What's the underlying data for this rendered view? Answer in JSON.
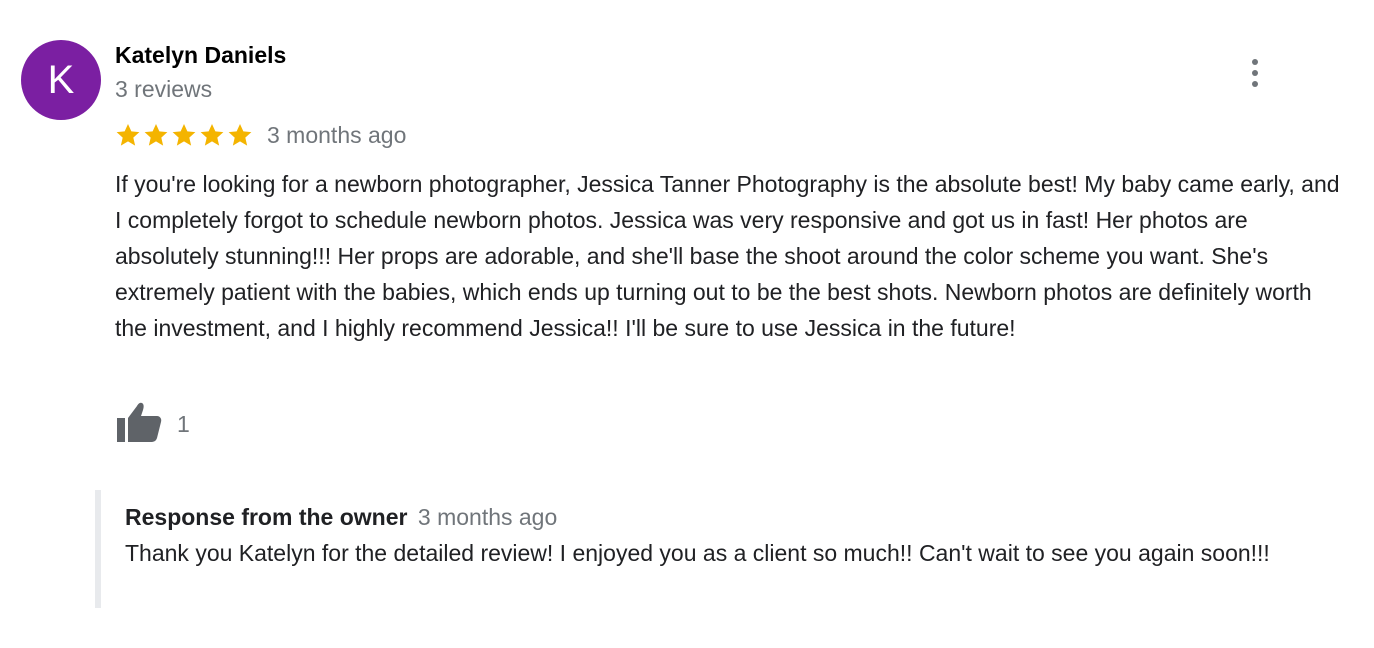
{
  "review": {
    "avatar_letter": "K",
    "avatar_color": "#7b1fa2",
    "author_name": "Katelyn Daniels",
    "review_count": "3 reviews",
    "menu_icon": "more-vert-icon",
    "rating": 5,
    "rating_max": 5,
    "star_color": "#f4b400",
    "date": "3 months ago",
    "text": "If you're looking for a newborn photographer, Jessica Tanner Photography is the absolute best! My baby came early, and I completely forgot to schedule newborn photos. Jessica was very responsive and got us in fast! Her photos are absolutely stunning!!! Her props are adorable, and she'll base the shoot around the color scheme you want. She's extremely patient with the babies, which ends up turning out to be the best shots. Newborn photos are definitely worth the investment, and I highly recommend Jessica!! I'll be sure to use Jessica in the future!",
    "like_icon": "thumbs-up-icon",
    "like_count": "1"
  },
  "owner_response": {
    "title": "Response from the owner",
    "date": "3 months ago",
    "text": "Thank you Katelyn for the detailed review! I enjoyed you as a client so much!! Can't wait to see you again soon!!!"
  }
}
